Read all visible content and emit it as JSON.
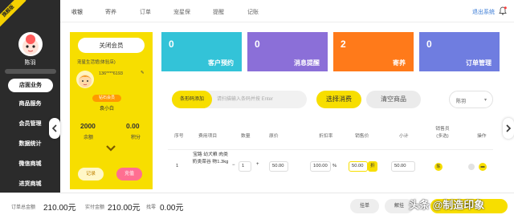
{
  "sidebar": {
    "ribbon": "旗舰版",
    "store_name": "陈羽",
    "items": [
      {
        "label": "店面业务",
        "active": true
      },
      {
        "label": "商品服务"
      },
      {
        "label": "会员管理"
      },
      {
        "label": "数据统计"
      },
      {
        "label": "微信商城"
      },
      {
        "label": "进货商城"
      }
    ]
  },
  "topnav": {
    "items": [
      "收银",
      "寄养",
      "订单",
      "宠星保",
      "提醒",
      "记账"
    ],
    "logout": "退出系统",
    "bell_icon": "bell-icon"
  },
  "member": {
    "close_button": "关闭会员",
    "shop": "宠星生活馆(体验店)",
    "phone": "136****6193",
    "level": "钻石会员",
    "name": "袁小白",
    "balance_value": "2000",
    "balance_label": "余额",
    "points_value": "0.00",
    "points_label": "积分",
    "record_button": "记录",
    "recharge_button": "充值"
  },
  "tiles": [
    {
      "value": "0",
      "label": "客户预约",
      "color": "#33c3d8"
    },
    {
      "value": "0",
      "label": "消息提醒",
      "color": "#8b6fd8"
    },
    {
      "value": "2",
      "label": "寄养",
      "color": "#ff7a1a"
    },
    {
      "value": "0",
      "label": "订单管理",
      "color": "#6f7de0"
    }
  ],
  "order": {
    "barcode_button": "条形码添加",
    "barcode_placeholder": "请扫描输入条码并按 Enter",
    "select_button": "选择消费",
    "clear_button": "清空商品",
    "staff_value": "陈羽",
    "columns": [
      "序号",
      "费用项目",
      "数量",
      "原价",
      "折扣率",
      "销售价",
      "小计",
      "销售员\n(多选)",
      "操作"
    ],
    "rows": [
      {
        "index": "1",
        "item": "宝路 幼犬粮 肉类奶类菜谷 物1.3kg",
        "qty": "1",
        "price": "50.00",
        "discount": "100.00",
        "discount_unit": "%",
        "sale_price": "50.00",
        "sale_tag": "折",
        "subtotal": "50.00",
        "staff": "陈"
      }
    ]
  },
  "bottom": {
    "total_label": "订单总金额",
    "total_value": "210.00元",
    "paid_label": "实付金额",
    "paid_value": "210.00元",
    "change_label": "找零",
    "change_value": "0.00元",
    "hold_button": "挂单",
    "resume_button": "解挂",
    "checkout_button": "收款"
  },
  "watermark": "头条 @制造印象"
}
